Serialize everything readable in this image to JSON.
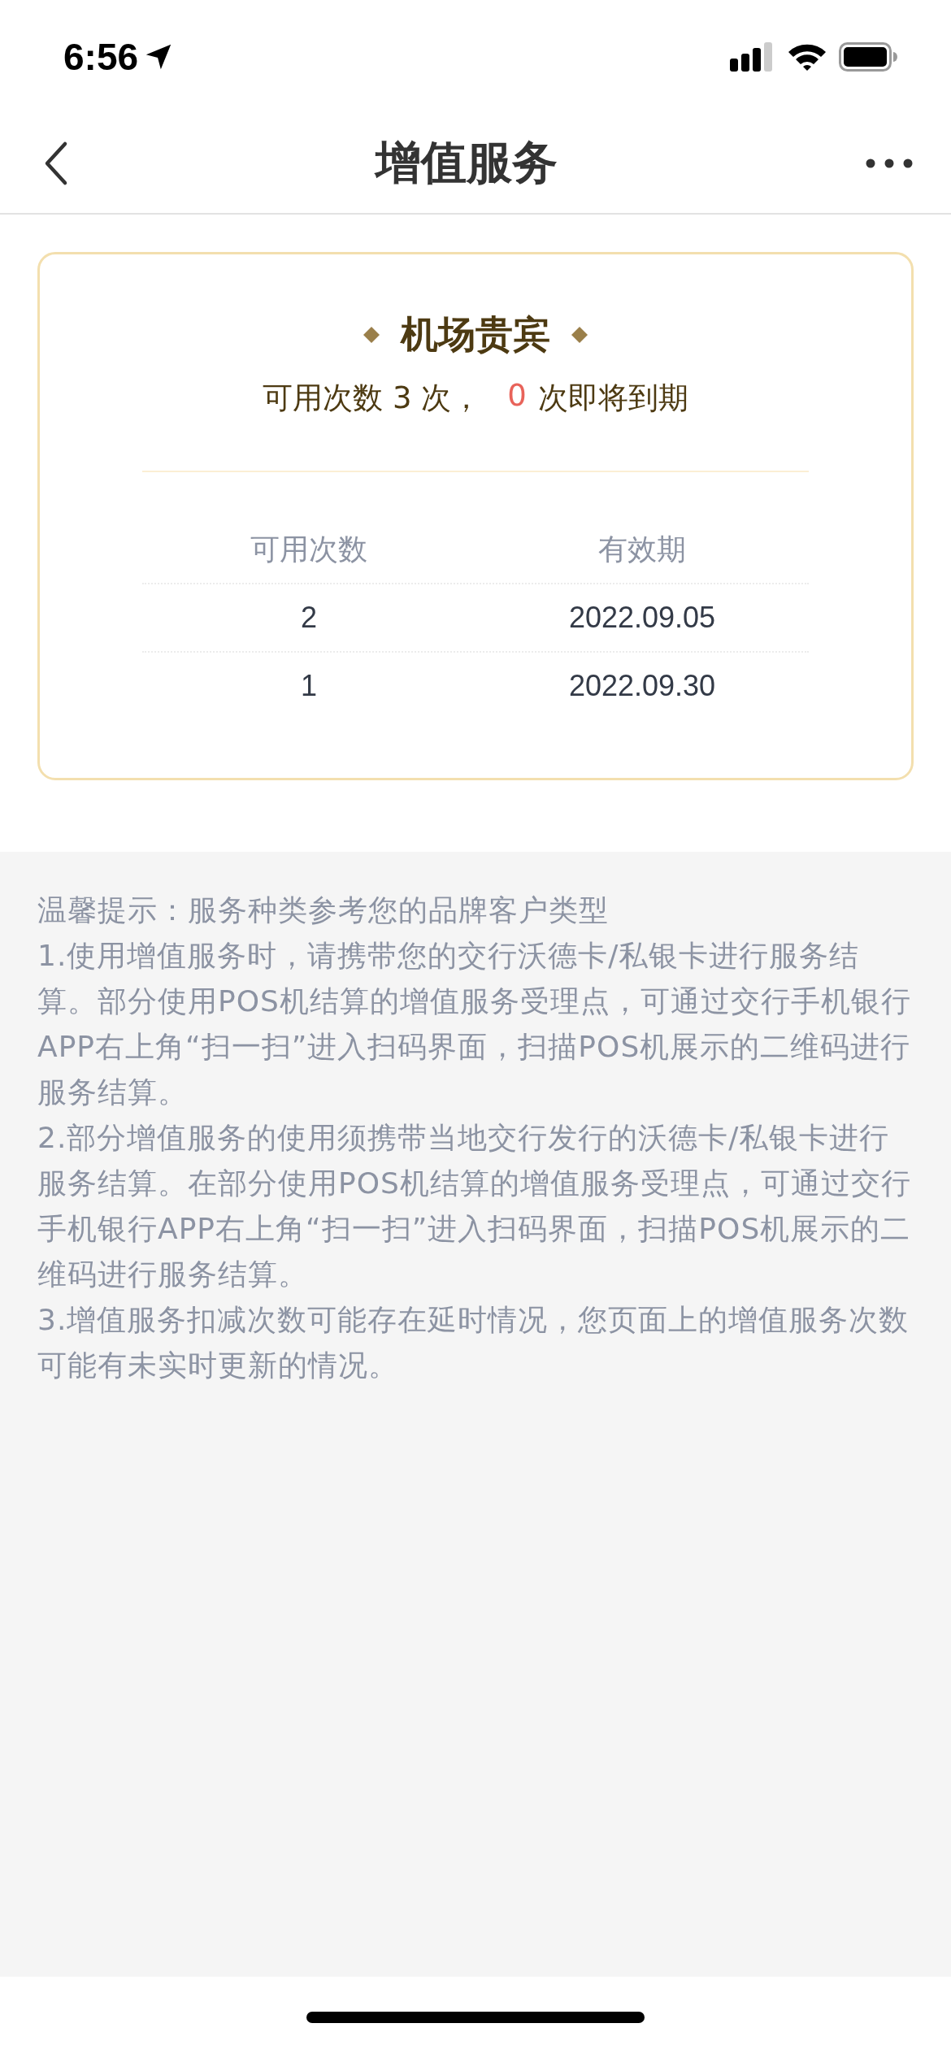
{
  "status_bar": {
    "time": "6:56"
  },
  "nav": {
    "title": "增值服务"
  },
  "card": {
    "title": "机场贵宾",
    "summary_prefix": "可用次数 3 次，",
    "expiring_count": "0",
    "summary_suffix": "次即将到期",
    "table": {
      "columns": [
        "可用次数",
        "有效期"
      ],
      "rows": [
        [
          "2",
          "2022.09.05"
        ],
        [
          "1",
          "2022.09.30"
        ]
      ]
    }
  },
  "notes": [
    "温馨提示：服务种类参考您的品牌客户类型",
    "1.使用增值服务时，请携带您的交行沃德卡/私银卡进行服务结算。部分使用POS机结算的增值服务受理点，可通过交行手机银行APP右上角“扫一扫”进入扫码界面，扫描POS机展示的二维码进行服务结算。",
    "2.部分增值服务的使用须携带当地交行发行的沃德卡/私银卡进行服务结算。在部分使用POS机结算的增值服务受理点，可通过交行手机银行APP右上角“扫一扫”进入扫码界面，扫描POS机展示的二维码进行服务结算。",
    "3.增值服务扣减次数可能存在延时情况，您页面上的增值服务次数可能有未实时更新的情况。"
  ]
}
